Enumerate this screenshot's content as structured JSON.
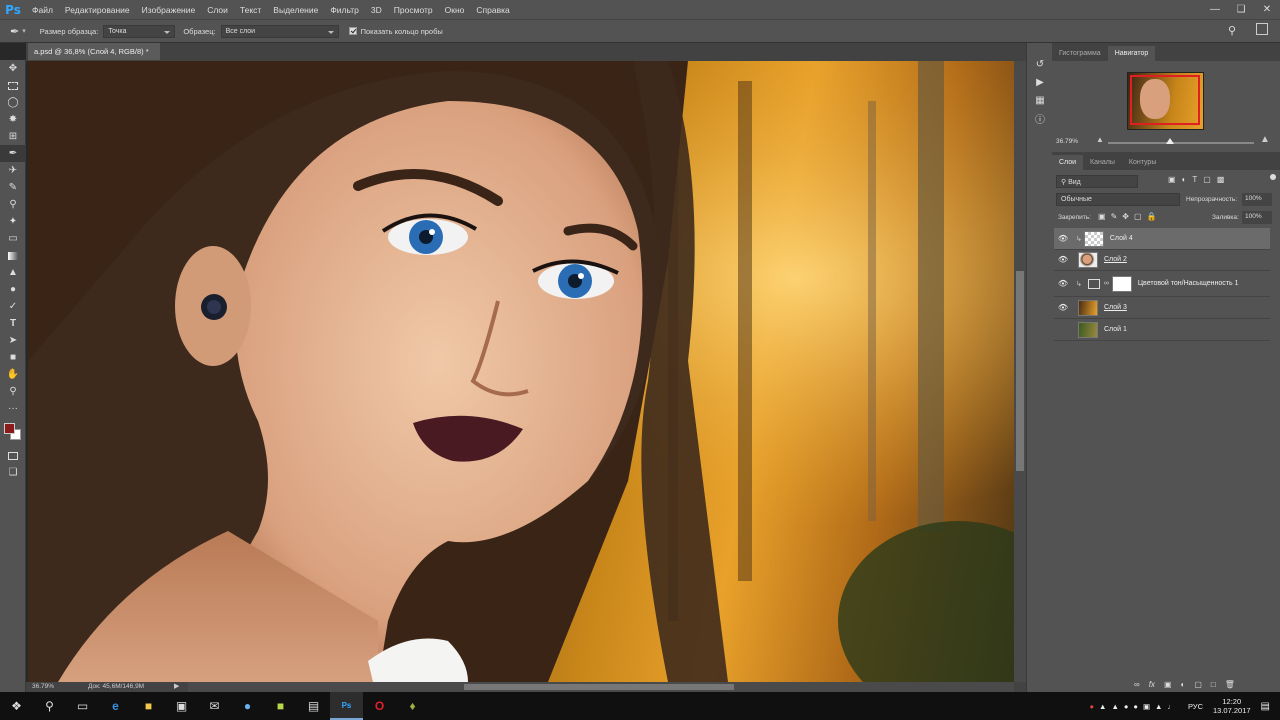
{
  "app": {
    "logo": "Ps"
  },
  "menu": [
    "Файл",
    "Редактирование",
    "Изображение",
    "Слои",
    "Текст",
    "Выделение",
    "Фильтр",
    "3D",
    "Просмотр",
    "Окно",
    "Справка"
  ],
  "options": {
    "sample_size_label": "Размер образца:",
    "sample_size_value": "Точка",
    "sample_label": "Образец:",
    "sample_value": "Все слои",
    "show_ring_label": "Показать кольцо пробы"
  },
  "document": {
    "tab_title": "a.psd @ 36,8% (Слой 4, RGB/8) *",
    "zoom": "36.79%",
    "doc_size": "Док: 45,6M/146,9M"
  },
  "panels": {
    "top_tabs": [
      "Гистограмма",
      "Навигатор"
    ],
    "navigator_zoom": "36.79%",
    "layer_tabs": [
      "Слои",
      "Каналы",
      "Контуры"
    ],
    "kind_filter": "Вид",
    "blend_mode": "Обычные",
    "opacity_label": "Непрозрачность:",
    "opacity_value": "100%",
    "lock_label": "Закрепить:",
    "fill_label": "Заливка:",
    "fill_value": "100%"
  },
  "layers": [
    {
      "name": "Слой 4",
      "selected": true,
      "visible": true
    },
    {
      "name": "Слой 2",
      "selected": false,
      "visible": true
    },
    {
      "name": "Цветовой тон/Насыщенность 1",
      "selected": false,
      "visible": true
    },
    {
      "name": "Слой 3",
      "selected": false,
      "visible": true
    },
    {
      "name": "Слой 1",
      "selected": false,
      "visible": false
    }
  ],
  "taskbar": {
    "lang": "РУС",
    "time": "12:20",
    "date": "13.07.2017"
  },
  "colors": {
    "foreground": "#8b1a1a",
    "background": "#ffffff",
    "ps_blue": "#31a8ff"
  }
}
